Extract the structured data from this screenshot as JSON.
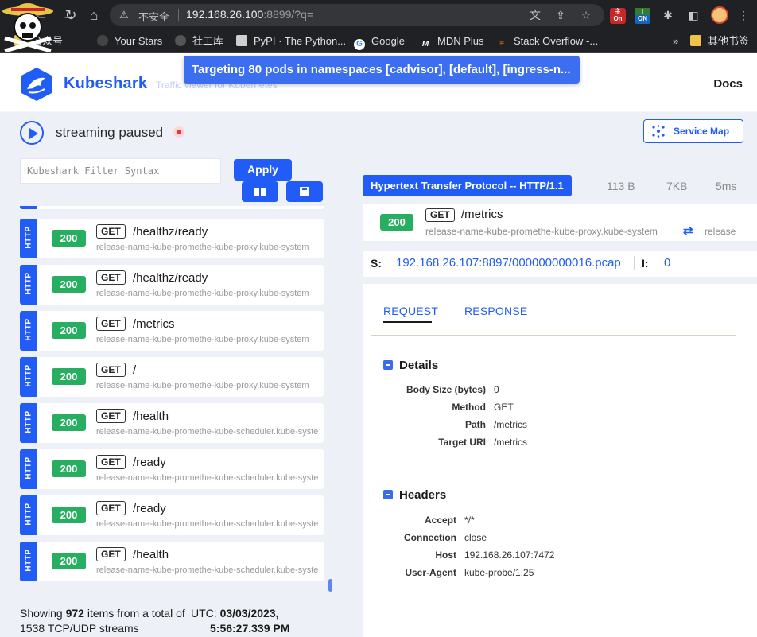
{
  "browser": {
    "security_label": "不安全",
    "url_host": "192.168.26.100",
    "url_rest": ":8899/?q=",
    "bookmarks": [
      {
        "label": "公众号",
        "icon": "folder-icon"
      },
      {
        "label": "Your Stars",
        "icon": "github-icon"
      },
      {
        "label": "社工库",
        "icon": "globe-icon"
      },
      {
        "label": "PyPI · The Python...",
        "icon": "cube-icon"
      },
      {
        "label": "Google",
        "icon": "google-icon"
      },
      {
        "label": "MDN Plus",
        "icon": "mdn-icon"
      },
      {
        "label": "Stack Overflow -...",
        "icon": "stackoverflow-icon"
      }
    ],
    "more_label": "»",
    "other_bookmarks": "其他书签",
    "ext_badges": [
      "On",
      "ON"
    ]
  },
  "header": {
    "brand": "Kubeshark",
    "tagline": "Traffic viewer for Kubernetes",
    "docs": "Docs",
    "toast": "Targeting 80 pods in namespaces [cadvisor], [default], [ingress-n..."
  },
  "status": {
    "label": "streaming paused",
    "service_map": "Service Map"
  },
  "filter": {
    "placeholder": "Kubeshark Filter Syntax",
    "apply": "Apply"
  },
  "entries": [
    {
      "protocol": "HTTP",
      "status": "200",
      "method": "GET",
      "path": "/healthz/ready",
      "source": "release-name-kube-promethe-kube-proxy.kube-system"
    },
    {
      "protocol": "HTTP",
      "status": "200",
      "method": "GET",
      "path": "/healthz/ready",
      "source": "release-name-kube-promethe-kube-proxy.kube-system"
    },
    {
      "protocol": "HTTP",
      "status": "200",
      "method": "GET",
      "path": "/metrics",
      "source": "release-name-kube-promethe-kube-proxy.kube-system"
    },
    {
      "protocol": "HTTP",
      "status": "200",
      "method": "GET",
      "path": "/",
      "source": "release-name-kube-promethe-kube-proxy.kube-system"
    },
    {
      "protocol": "HTTP",
      "status": "200",
      "method": "GET",
      "path": "/health",
      "source": "release-name-kube-promethe-kube-scheduler.kube-system"
    },
    {
      "protocol": "HTTP",
      "status": "200",
      "method": "GET",
      "path": "/ready",
      "source": "release-name-kube-promethe-kube-scheduler.kube-system"
    },
    {
      "protocol": "HTTP",
      "status": "200",
      "method": "GET",
      "path": "/ready",
      "source": "release-name-kube-promethe-kube-scheduler.kube-system"
    },
    {
      "protocol": "HTTP",
      "status": "200",
      "method": "GET",
      "path": "/health",
      "source": "release-name-kube-promethe-kube-scheduler.kube-system"
    }
  ],
  "footer": {
    "prefix": "Showing ",
    "shown": "972",
    "middle": " items from a total of",
    "total": "1538",
    "suffix": " TCP/UDP streams",
    "utc_label": "UTC: ",
    "utc_date": "03/03/2023,",
    "utc_time": "5:56:27.339 PM"
  },
  "detail": {
    "protocol": "Hypertext Transfer Protocol -- HTTP/1.1",
    "size": "113 B",
    "total_size": "7KB",
    "elapsed": "5ms",
    "status": "200",
    "method": "GET",
    "path": "/metrics",
    "source": "release-name-kube-promethe-kube-proxy.kube-system",
    "destination": "release",
    "pcap_label": "S:",
    "pcap_file": "192.168.26.107:8897/000000000016.pcap",
    "index_label": "I:",
    "index": "0",
    "tabs": [
      "REQUEST",
      "RESPONSE"
    ],
    "details_title": "Details",
    "details": [
      {
        "key": "Body Size (bytes)",
        "value": "0"
      },
      {
        "key": "Method",
        "value": "GET"
      },
      {
        "key": "Path",
        "value": "/metrics"
      },
      {
        "key": "Target URI",
        "value": "/metrics"
      }
    ],
    "headers_title": "Headers",
    "headers": [
      {
        "key": "Accept",
        "value": "*/*"
      },
      {
        "key": "Connection",
        "value": "close"
      },
      {
        "key": "Host",
        "value": "192.168.26.107:7472"
      },
      {
        "key": "User-Agent",
        "value": "kube-probe/1.25"
      }
    ]
  },
  "colors": {
    "accent": "#205cf5",
    "success": "#27ae60",
    "toast": "#3c6ff0",
    "url_highlight": "#e53935"
  }
}
